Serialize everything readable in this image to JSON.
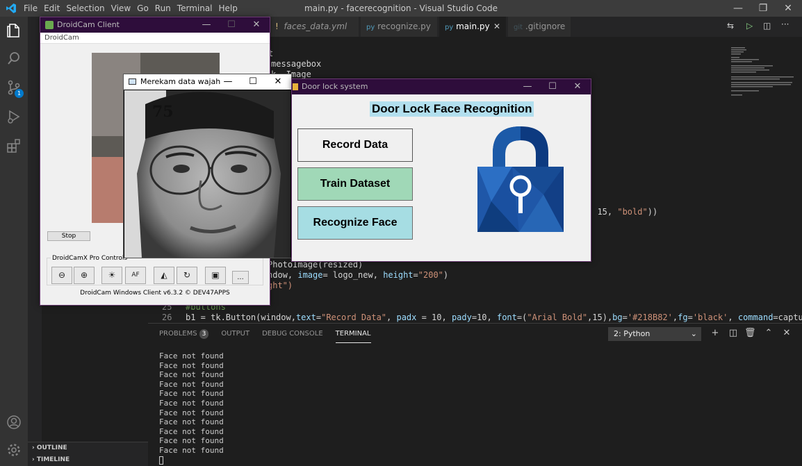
{
  "vscode": {
    "menus": [
      "File",
      "Edit",
      "Selection",
      "View",
      "Go",
      "Run",
      "Terminal",
      "Help"
    ],
    "window_title": "main.py - facerecognition - Visual Studio Code",
    "scm_badge": "1",
    "tabs": [
      {
        "label": "faces_data.yml",
        "icon": "!",
        "active": false
      },
      {
        "label": "recognize.py",
        "icon": "py",
        "active": false
      },
      {
        "label": "main.py",
        "icon": "py",
        "active": true,
        "close": "✕"
      },
      {
        "label": ".gitignore",
        "icon": "git",
        "active": false
      }
    ],
    "code": {
      "l_frag1": "t",
      "l_frag2": "messagebox",
      "l_frag3": "k, Image",
      "l_frag4a": ", 15, ",
      "l_frag4b": "\"bold\"",
      "l_frag4c": "))",
      "l_frag5": "PhotoImage(resized)",
      "l_frag6a": "ndow, ",
      "l_frag6b": "image",
      "l_frag6c": "= logo_new, ",
      "l_frag6d": "height",
      "l_frag6e": "=",
      "l_frag6f": "\"200\"",
      "l_frag6g": ")",
      "l_frag7": "ght\")",
      "line25_num": "25",
      "line25_text": "#buttons",
      "line26_num": "26",
      "line26_pre": "b1 = tk.Button(window,",
      "line26_text_attr": "text",
      "line26_text_val": "\"Record Data\"",
      "line26_padx_attr": "padx",
      "line26_padx_val": " = 10, ",
      "line26_pady_attr": "pady",
      "line26_pady_val": "=10, ",
      "line26_font_attr": "font",
      "line26_font_val1": "=(",
      "line26_font_str": "\"Arial Bold\"",
      "line26_font_val2": ",15),",
      "line26_bg_attr": "bg",
      "line26_bg_val": "'#218B82'",
      "line26_fg_attr": "fg",
      "line26_fg_val": "'black'",
      "line26_cmd_attr": "command",
      "line26_cmd_val": "=capture."
    },
    "panel": {
      "tabs": [
        {
          "label": "PROBLEMS",
          "badge": "3"
        },
        {
          "label": "OUTPUT"
        },
        {
          "label": "DEBUG CONSOLE"
        },
        {
          "label": "TERMINAL",
          "active": true
        }
      ],
      "terminal_select": "2: Python",
      "terminal_lines": [
        "Face not found",
        "Face not found",
        "Face not found",
        "Face not found",
        "Face not found",
        "Face not found",
        "Face not found",
        "Face not found",
        "Face not found",
        "Face not found",
        "Face not found"
      ]
    },
    "sidebar_sections": [
      "OUTLINE",
      "TIMELINE"
    ]
  },
  "droidcam": {
    "title": "DroidCam Client",
    "menu": "DroidCam",
    "stop_label": "Stop",
    "pro_controls_label": "DroidCamX Pro Controls",
    "af_label": "AF",
    "more_label": "...",
    "footer": "DroidCam Windows Client v6.3.2 © DEV47APPS"
  },
  "merekam": {
    "title": "Merekam data wajah",
    "count": "75"
  },
  "doorlock": {
    "title": "Door lock system",
    "heading": "Door Lock Face Recognition",
    "buttons": [
      {
        "label": "Record Data",
        "bg": "#f0f0f0"
      },
      {
        "label": "Train Dataset",
        "bg": "#a0d8b7"
      },
      {
        "label": "Recognize Face",
        "bg": "#a6dde3"
      }
    ]
  },
  "colors": {
    "accent": "#007acc",
    "lock_dark": "#0d3a80",
    "lock_light": "#2a6fc2"
  }
}
